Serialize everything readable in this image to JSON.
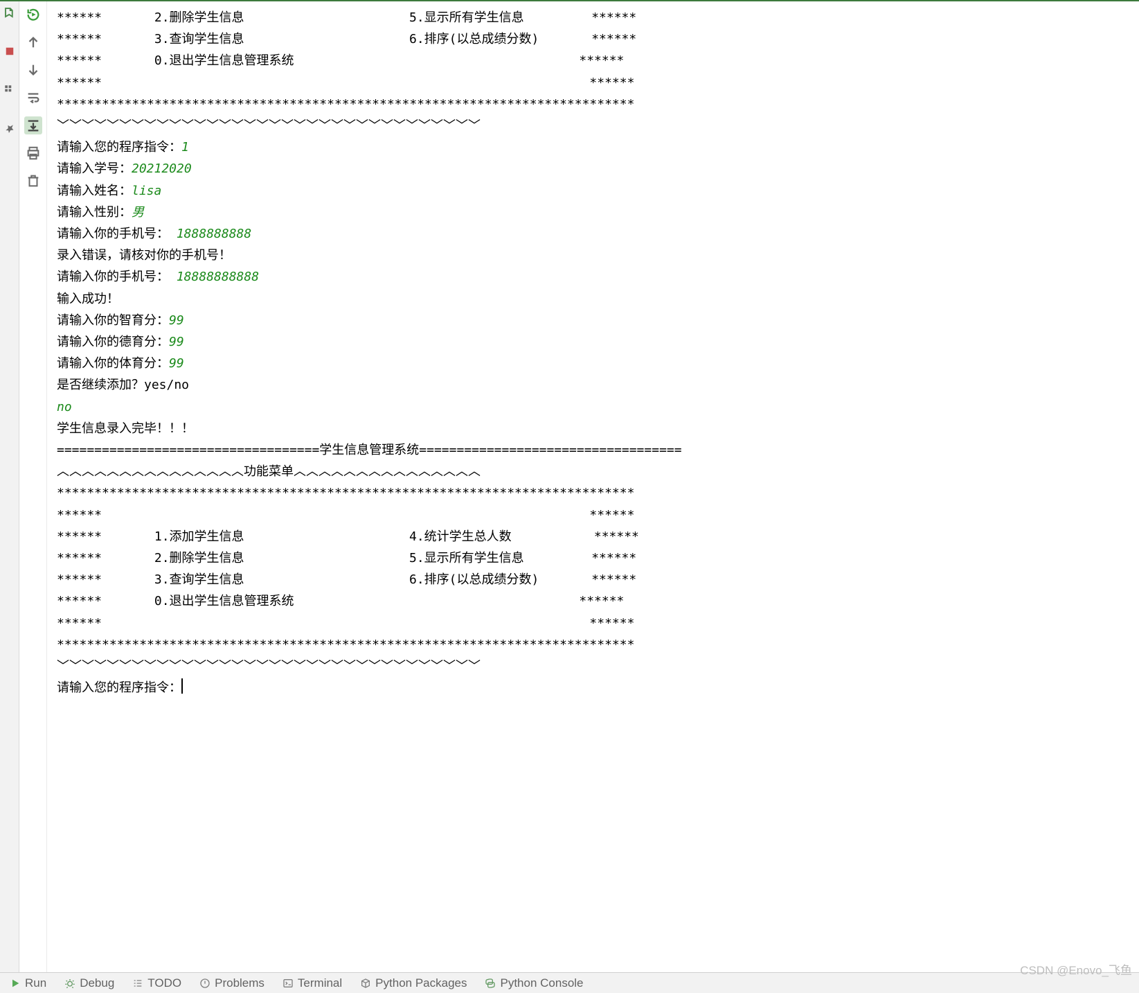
{
  "menu1": {
    "rowA_left": "******       2.删除学生信息",
    "rowA_right": "5.显示所有学生信息         ******",
    "rowB_left": "******       3.查询学生信息",
    "rowB_right": "6.排序(以总成绩分数)       ******",
    "rowC": "******       0.退出学生信息管理系统                                      ******",
    "rowD": "******                                                                 ******",
    "stars": "*****************************************************************************",
    "waves": "﹀﹀﹀﹀﹀﹀﹀﹀﹀﹀﹀﹀﹀﹀﹀﹀﹀﹀﹀﹀﹀﹀﹀﹀﹀﹀﹀﹀﹀﹀﹀﹀﹀﹀"
  },
  "io": {
    "p1": "请输入您的程序指令：",
    "v1": "1",
    "p2": "请输入学号：",
    "v2": "20212020",
    "p3": "请输入姓名：",
    "v3": "lisa",
    "p4": "请输入性别：",
    "v4": "男",
    "p5": "请输入你的手机号： ",
    "v5": "1888888888",
    "err": "录入错误，请核对你的手机号！",
    "p6": "请输入你的手机号： ",
    "v6": "18888888888",
    "ok": "输入成功！",
    "p7": "请输入你的智育分：",
    "v7": "99",
    "p8": "请输入你的德育分：",
    "v8": "99",
    "p9": "请输入你的体育分：",
    "v9": "99",
    "p10": "是否继续添加？yes/no",
    "v10": "no",
    "done": "学生信息录入完毕！！！"
  },
  "menu2": {
    "titlebar": "===================================学生信息管理系统===================================",
    "menubar": "︿︿︿︿︿︿︿︿︿︿︿︿︿︿︿功能菜单︿︿︿︿︿︿︿︿︿︿︿︿︿︿︿",
    "stars": "*****************************************************************************",
    "blank": "******                                                                 ******",
    "r1l": "******       1.添加学生信息",
    "r1r": "4.统计学生总人数           ******",
    "r2l": "******       2.删除学生信息",
    "r2r": "5.显示所有学生信息         ******",
    "r3l": "******       3.查询学生信息",
    "r3r": "6.排序(以总成绩分数)       ******",
    "r4": "******       0.退出学生信息管理系统                                      ******",
    "waves": "﹀﹀﹀﹀﹀﹀﹀﹀﹀﹀﹀﹀﹀﹀﹀﹀﹀﹀﹀﹀﹀﹀﹀﹀﹀﹀﹀﹀﹀﹀﹀﹀﹀﹀",
    "prompt": "请输入您的程序指令："
  },
  "bottom": {
    "run": "Run",
    "debug": "Debug",
    "todo": "TODO",
    "problems": "Problems",
    "terminal": "Terminal",
    "pypkg": "Python Packages",
    "pyconsole": "Python Console"
  },
  "watermark": "CSDN @Enovo_飞鱼"
}
